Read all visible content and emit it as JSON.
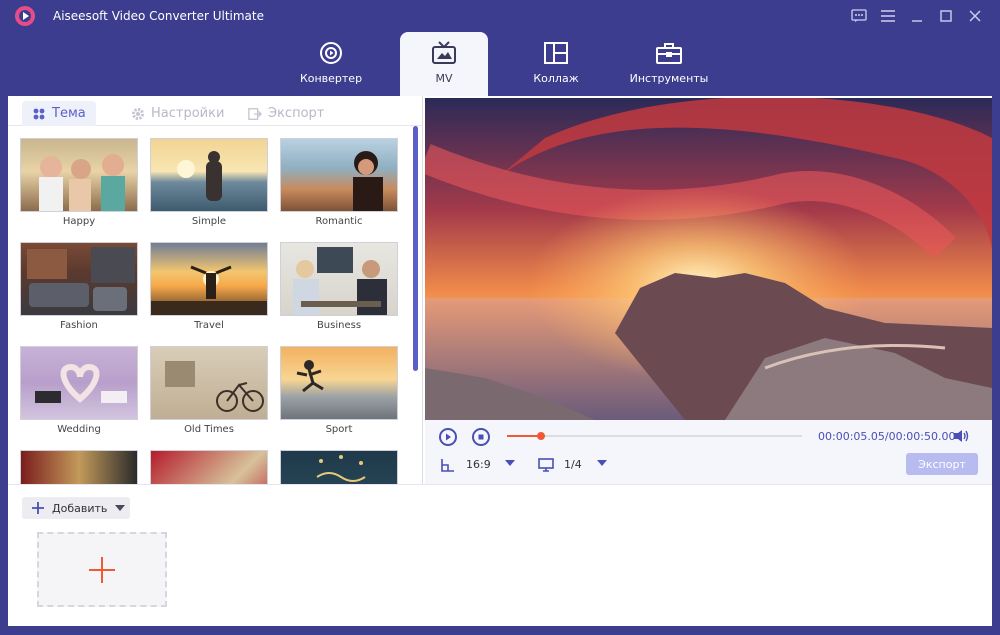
{
  "app": {
    "title": "Aiseesoft Video Converter Ultimate"
  },
  "tabs": [
    {
      "label": "Конвертер",
      "icon": "convert-icon"
    },
    {
      "label": "MV",
      "icon": "tv-icon"
    },
    {
      "label": "Коллаж",
      "icon": "collage-icon"
    },
    {
      "label": "Инструменты",
      "icon": "toolbox-icon"
    }
  ],
  "subtabs": [
    {
      "label": "Тема",
      "icon": "grid-icon"
    },
    {
      "label": "Настройки",
      "icon": "gear-icon"
    },
    {
      "label": "Экспорт",
      "icon": "export-icon"
    }
  ],
  "themes": [
    {
      "label": "Happy"
    },
    {
      "label": "Simple"
    },
    {
      "label": "Romantic"
    },
    {
      "label": "Fashion"
    },
    {
      "label": "Travel"
    },
    {
      "label": "Business"
    },
    {
      "label": "Wedding"
    },
    {
      "label": "Old Times"
    },
    {
      "label": "Sport"
    }
  ],
  "player": {
    "time": "00:00:05.05/00:00:50.00",
    "progress": 0.115,
    "aspect": "16:9",
    "page": "1/4",
    "export_label": "Экспорт"
  },
  "add": {
    "label": "Добавить"
  },
  "colors": {
    "accent": "#5b5fc7",
    "orange": "#ef5a35",
    "frame": "#3d3d8f"
  }
}
